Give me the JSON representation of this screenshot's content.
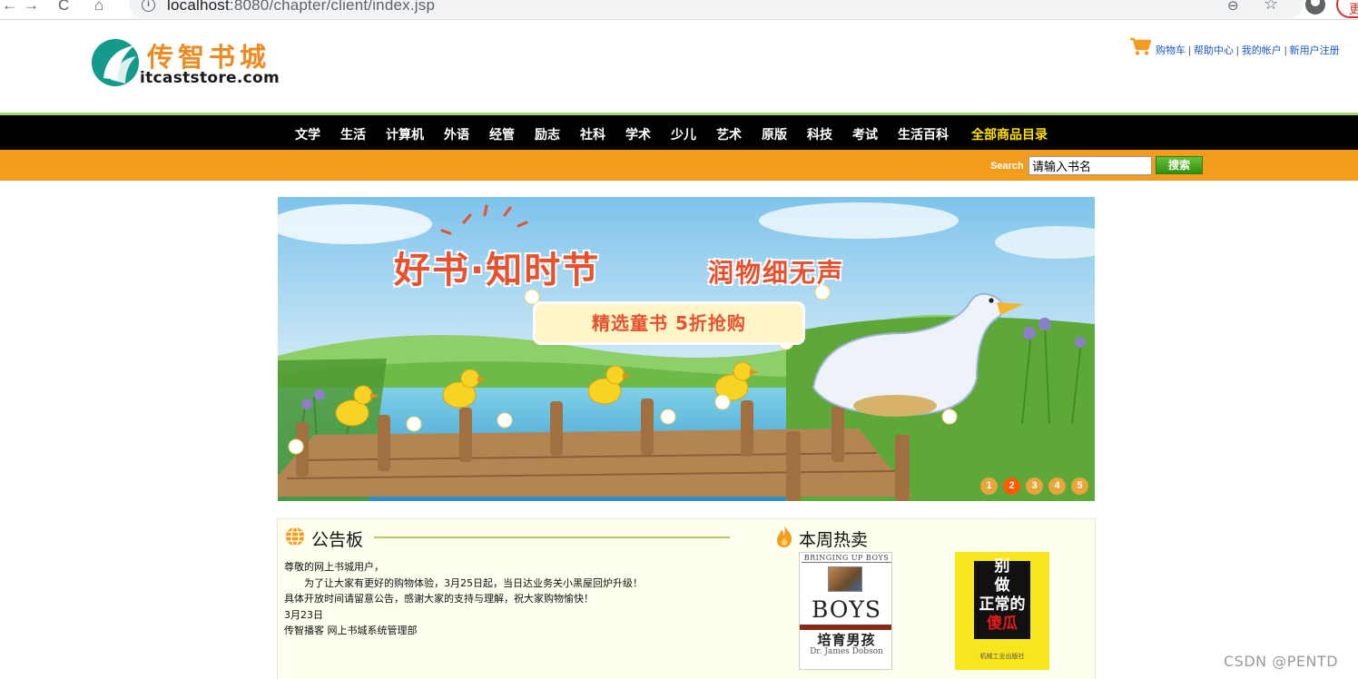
{
  "browser": {
    "back_glyph": "←",
    "forward_glyph": "→",
    "reload_glyph": "C",
    "home_glyph": "⌂",
    "info_glyph": "i",
    "url_host": "localhost",
    "url_rest": ":8080/chapter/client/index.jsp",
    "zoom_glyph": "⊖",
    "star_glyph": "☆",
    "update_label": "更"
  },
  "header": {
    "logo_cn": "传智书城",
    "logo_en": "itcaststore.com",
    "links": {
      "cart": "购物车",
      "help": "帮助中心",
      "account": "我的帐户",
      "register": "新用户注册",
      "separator": "|"
    }
  },
  "nav": {
    "items": [
      "文学",
      "生活",
      "计算机",
      "外语",
      "经管",
      "励志",
      "社科",
      "学术",
      "少儿",
      "艺术",
      "原版",
      "科技",
      "考试",
      "生活百科"
    ],
    "all_items": "全部商品目录"
  },
  "search": {
    "label": "Search",
    "input_value": "请输入书名",
    "button_label": "搜索"
  },
  "banner": {
    "title": "好书·知时节",
    "subtitle": "润物细无声",
    "promo": "精选童书 5折抢购",
    "dots": [
      "1",
      "2",
      "3",
      "4",
      "5"
    ],
    "active_dot": "2"
  },
  "notice": {
    "title": "公告板",
    "lines": [
      "尊敬的网上书城用户，",
      "为了让大家有更好的购物体验，3月25日起，当日达业务关小黑屋回炉升级！",
      "具体开放时间请留意公告，感谢大家的支持与理解，祝大家购物愉快！",
      "3月23日",
      "传智播客 网上书城系统管理部"
    ]
  },
  "hot": {
    "title": "本周热卖",
    "books": [
      {
        "top_text": "BRINGING UP BOYS",
        "big_text": "BOYS",
        "cn_title": "培育男孩",
        "author": "Dr. James Dobson"
      },
      {
        "title_line1": "别",
        "title_line2": "做",
        "title_line3": "正常的",
        "title_line4": "傻瓜",
        "foot": "机械工业出版社"
      }
    ]
  },
  "watermark": "CSDN @PENTD",
  "colors": {
    "nav_bg": "#000000",
    "search_bar": "#f39c1e",
    "accent_green": "#a5d36b",
    "link_blue": "#1a56c4",
    "all_items_yellow": "#ffe000",
    "banner_red": "#e8502e"
  }
}
